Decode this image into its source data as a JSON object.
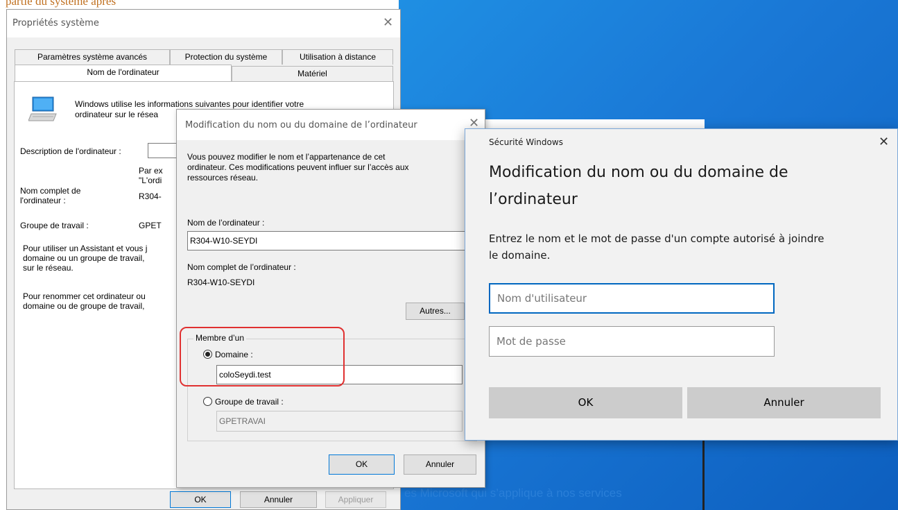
{
  "crop_caption": "partie du système après",
  "desktop": {
    "footer_text": "es Microsoft qui s’applique à nos services"
  },
  "system_props": {
    "title": "Propriétés système",
    "tabs_row1": [
      "Paramètres système avancés",
      "Protection du système",
      "Utilisation à distance"
    ],
    "tabs_row2": [
      "Nom de l'ordinateur",
      "Matériel"
    ],
    "info_text_1": "Windows utilise les informations suivantes pour identifier votre",
    "info_text_2": "ordinateur sur le résea",
    "description_label": "Description de l'ordinateur :",
    "example_1": "Par ex",
    "example_2": "\"L'ordi",
    "fullname_label_1": "Nom complet de",
    "fullname_label_2": "l'ordinateur :",
    "fullname_value": "R304-",
    "workgroup_label": "Groupe de travail :",
    "workgroup_value": "GPET",
    "assist_1": "Pour utiliser un Assistant et vous j",
    "assist_2": "domaine ou un groupe de travail,",
    "assist_3": "sur le réseau.",
    "rename_1": "Pour renommer cet ordinateur ou",
    "rename_2": "domaine ou de groupe de travail,",
    "ok": "OK",
    "cancel": "Annuler",
    "apply": "Appliquer"
  },
  "modify_dialog": {
    "title": "Modification du nom ou du domaine de l’ordinateur",
    "desc_1": "Vous pouvez modifier le nom et l’appartenance de cet",
    "desc_2": "ordinateur. Ces modifications peuvent influer sur l’accès aux",
    "desc_3": "ressources réseau.",
    "name_label": "Nom de l’ordinateur :",
    "name_value": "R304-W10-SEYDI",
    "fullname_label": "Nom complet de l’ordinateur :",
    "fullname_value": "R304-W10-SEYDI",
    "more": "Autres...",
    "member_of": "Membre d’un",
    "domain_label": "Domaine :",
    "domain_value": "coloSeydi.test",
    "workgroup_label": "Groupe de travail :",
    "workgroup_value": "GPETRAVAI",
    "ok": "OK",
    "cancel": "Annuler"
  },
  "security": {
    "title": "Sécurité Windows",
    "heading_1": "Modification du nom ou du domaine de",
    "heading_2": "l’ordinateur",
    "body_1": "Entrez le nom et le mot de passe d'un compte autorisé à joindre",
    "body_2": "le domaine.",
    "username_placeholder": "Nom d'utilisateur",
    "password_placeholder": "Mot de passe",
    "ok": "OK",
    "cancel": "Annuler"
  }
}
